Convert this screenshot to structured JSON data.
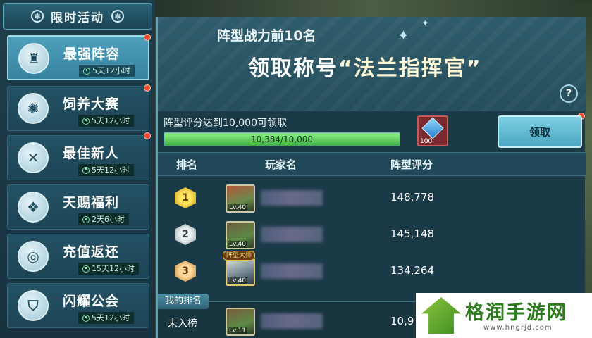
{
  "sidebar": {
    "title": "限时活动",
    "items": [
      {
        "label": "最强阵容",
        "timer": "5天12小时",
        "icon": "tower-icon",
        "glyph": "♜",
        "active": true
      },
      {
        "label": "饲养大赛",
        "timer": "5天12小时",
        "icon": "swirl-icon",
        "glyph": "✺",
        "active": false
      },
      {
        "label": "最佳新人",
        "timer": "5天12小时",
        "icon": "crossed-swords-icon",
        "glyph": "✕",
        "active": false
      },
      {
        "label": "天赐福利",
        "timer": "2天6小时",
        "icon": "gift-hand-icon",
        "glyph": "❖",
        "active": false
      },
      {
        "label": "充值返还",
        "timer": "15天12小时",
        "icon": "recharge-icon",
        "glyph": "◎",
        "active": false
      },
      {
        "label": "闪耀公会",
        "timer": "5天12小时",
        "icon": "shield-icon",
        "glyph": "⛉",
        "active": false
      }
    ]
  },
  "banner": {
    "line1": "阵型战力前10名",
    "line2_prefix": "领取称号",
    "line2_title": "“法兰指挥官”",
    "help": "?"
  },
  "requirement": {
    "text": "阵型评分达到10,000可领取",
    "progress_text": "10,384/10,000",
    "progress_fraction": 1.0
  },
  "reward": {
    "icon": "diamond-icon",
    "quantity": "100"
  },
  "claim_button": "领取",
  "table": {
    "headers": {
      "rank": "排名",
      "player": "玩家名",
      "score": "阵型评分"
    },
    "rows": [
      {
        "rank": "1",
        "level": "Lv.40",
        "score": "148,778",
        "title_badge": ""
      },
      {
        "rank": "2",
        "level": "Lv.40",
        "score": "145,148",
        "title_badge": ""
      },
      {
        "rank": "3",
        "level": "Lv.40",
        "score": "134,264",
        "title_badge": "阵型大师"
      }
    ]
  },
  "my_rank": {
    "tag": "我的排名",
    "status": "未入榜",
    "level": "Lv.11",
    "score_partial": "10,9"
  },
  "watermark": {
    "text": "格润手游网",
    "url": "www.hngrjd.com"
  },
  "colors": {
    "accent": "#4fa0bb",
    "progress": "#3fb043",
    "alert_dot": "#f04a2a"
  }
}
